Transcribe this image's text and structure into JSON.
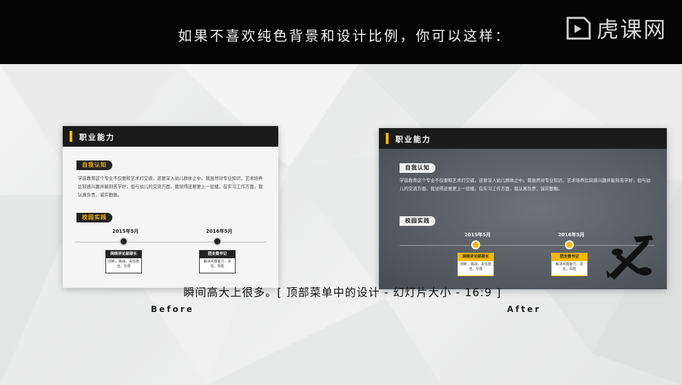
{
  "header": {
    "headline": "如果不喜欢纯色背景和设计比例，你可以这样：",
    "logo_text": "虎课网",
    "logo_icon": "tiger-course-logo-icon"
  },
  "before_slide": {
    "title": "职业能力",
    "tag_self": "自我认知",
    "paragraph": "学前教育这个专业不仅要和艺术打交道，还要深入幼儿群体之中。我虽然对专业知识、艺术培养比较感兴趣并能刻苦学好，但与幼儿的交流方面，我觉得还要更上一层楼。在实习工作方面，我认真负责，诚实勤勉。",
    "tag_campus": "校园实践",
    "timeline": [
      {
        "year": "2015年5月",
        "box_title": "网络评论部部长",
        "box_body": "创新，挑战，责任担当，乐观"
      },
      {
        "year": "2016年5月",
        "box_title": "团支委书记",
        "box_body": "解决问题能力，责任，风险"
      }
    ]
  },
  "after_slide": {
    "title": "职业能力",
    "tag_self": "自我认知",
    "paragraph": "学前教育这个专业不仅要和艺术打交道，还要深入幼儿群体之中。我虽然对专业知识、艺术培养比较感兴趣并能刻苦学好，但与幼儿的交流方面，我觉得还要更上一层楼。在实习工作方面，我认真负责，诚实勤勉。",
    "tag_campus": "校园实践",
    "timeline": [
      {
        "year": "2015年5月",
        "box_title": "网络评论部部长",
        "box_body": "创新，挑战，责任担当，乐观"
      },
      {
        "year": "2016年5月",
        "box_title": "团支委书记",
        "box_body": "解决问题能力，责任，风险"
      }
    ],
    "decoration_icon": "airplane-icon"
  },
  "labels": {
    "before": "Before",
    "after": "After"
  },
  "subtitle": "瞬间高大上很多。[ 顶部菜单中的设计 - 幻灯片大小 - 16:9 ]",
  "colors": {
    "accent": "#f5b800",
    "dark": "#1b1b1b",
    "after_bg": "#565c61"
  }
}
